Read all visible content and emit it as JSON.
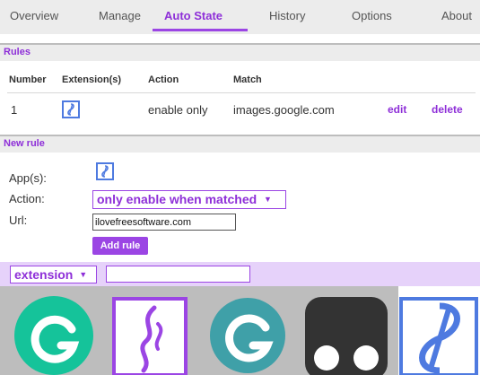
{
  "nav": {
    "tabs": [
      {
        "label": "Overview"
      },
      {
        "label": "Manage"
      },
      {
        "label": "Auto State",
        "active": true
      },
      {
        "label": "History"
      },
      {
        "label": "Options"
      },
      {
        "label": "About"
      }
    ]
  },
  "rules": {
    "header": "Rules",
    "columns": [
      "Number",
      "Extension(s)",
      "Action",
      "Match"
    ],
    "rows": [
      {
        "number": "1",
        "extension_icon": "app-icon",
        "action": "enable only",
        "match": "images.google.com",
        "edit_label": "edit",
        "delete_label": "delete"
      }
    ]
  },
  "new_rule": {
    "header": "New rule",
    "apps_label": "App(s):",
    "apps_icon": "app-icon",
    "action_label": "Action:",
    "action_value": "only enable when matched",
    "url_label": "Url:",
    "url_value": "ilovefreesoftware.com",
    "add_button": "Add rule"
  },
  "filter": {
    "type_value": "extension",
    "search_value": ""
  },
  "gallery": {
    "items": [
      {
        "icon": "grammarly-green-icon",
        "color": "#15c39a"
      },
      {
        "icon": "swirl-purple-icon",
        "color": "#9b45e4"
      },
      {
        "icon": "g-teal-icon",
        "color": "#3fa0a8"
      },
      {
        "icon": "tampermonkey-icon",
        "color": "#333333"
      },
      {
        "icon": "app-icon",
        "color": "#4e7ae0"
      }
    ]
  },
  "colors": {
    "accent": "#9b45e4",
    "accent_text": "#8e2fd8",
    "app_icon_blue": "#4e7ae0"
  }
}
